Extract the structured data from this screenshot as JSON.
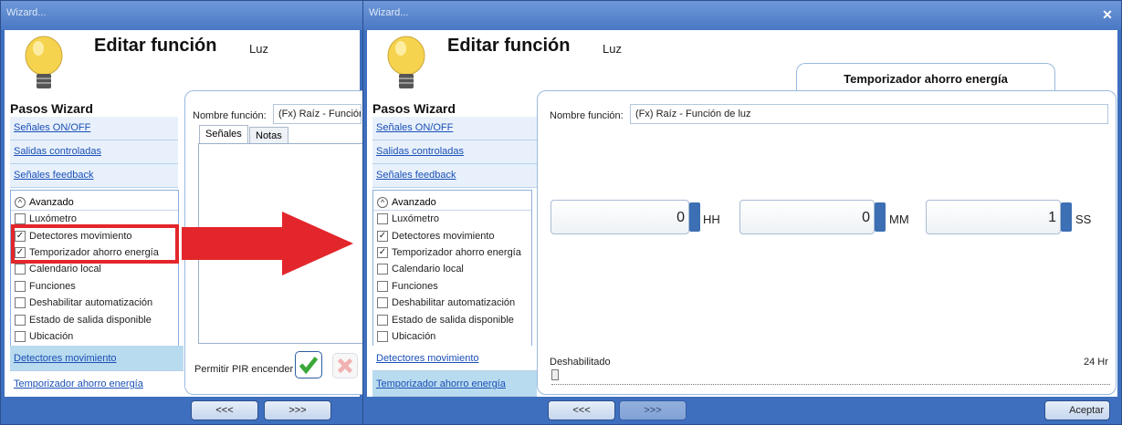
{
  "left": {
    "title": "Wizard...",
    "header_title": "Editar función",
    "header_subtitle": "Luz",
    "steps_title": "Pasos Wizard",
    "steps": [
      "Señales ON/OFF",
      "Salidas controladas",
      "Señales feedback"
    ],
    "advanced_label": "Avanzado",
    "advanced_items": [
      {
        "label": "Luxómetro",
        "checked": false
      },
      {
        "label": "Detectores movimiento",
        "checked": true
      },
      {
        "label": "Temporizador ahorro energía",
        "checked": true
      },
      {
        "label": "Calendario local",
        "checked": false
      },
      {
        "label": "Funciones",
        "checked": false
      },
      {
        "label": "Deshabilitar automatización",
        "checked": false
      },
      {
        "label": "Estado de salida disponible",
        "checked": false
      },
      {
        "label": "Ubicación",
        "checked": false
      }
    ],
    "bottom_steps": [
      "Detectores movimiento",
      "Temporizador ahorro energía"
    ],
    "name_label": "Nombre función:",
    "name_value": "(Fx) Raíz - Función",
    "tabs": [
      "Señales",
      "Notas"
    ],
    "pir_label": "Permitir PIR encender",
    "prev": "<<<",
    "next": ">>>"
  },
  "right": {
    "title": "Wizard...",
    "header_title": "Editar función",
    "header_subtitle": "Luz",
    "section_tab": "Temporizador ahorro energía",
    "steps_title": "Pasos Wizard",
    "steps": [
      "Señales ON/OFF",
      "Salidas controladas",
      "Señales feedback"
    ],
    "advanced_label": "Avanzado",
    "advanced_items": [
      {
        "label": "Luxómetro",
        "checked": false
      },
      {
        "label": "Detectores movimiento",
        "checked": true
      },
      {
        "label": "Temporizador ahorro energía",
        "checked": true
      },
      {
        "label": "Calendario local",
        "checked": false
      },
      {
        "label": "Funciones",
        "checked": false
      },
      {
        "label": "Deshabilitar automatización",
        "checked": false
      },
      {
        "label": "Estado de salida disponible",
        "checked": false
      },
      {
        "label": "Ubicación",
        "checked": false
      }
    ],
    "bottom_steps": [
      "Detectores movimiento",
      "Temporizador ahorro energía"
    ],
    "name_label": "Nombre función:",
    "name_value": "(Fx) Raíz - Función de luz",
    "hh_value": "0",
    "hh_label": "HH",
    "mm_value": "0",
    "mm_label": "MM",
    "ss_value": "1",
    "ss_label": "SS",
    "slider_min_label": "Deshabilitado",
    "slider_max_label": "24 Hr",
    "prev": "<<<",
    "next": ">>>",
    "accept": "Aceptar"
  },
  "colors": {
    "arrow": "#e3262b",
    "highlight_box": "#e3262b",
    "window_frame": "#3e6fbf",
    "check_green": "#3aa83a"
  }
}
